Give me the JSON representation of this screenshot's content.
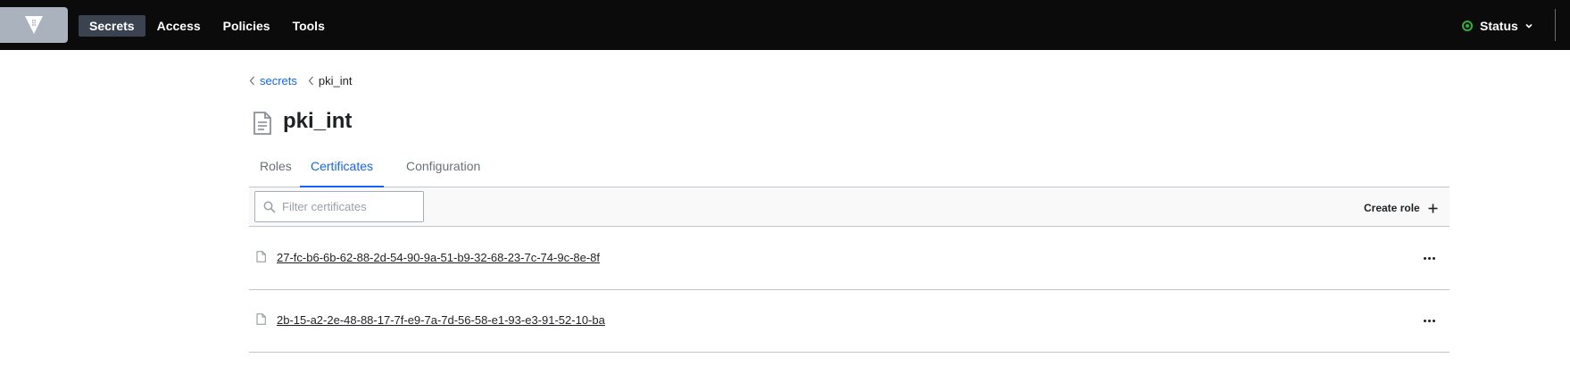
{
  "nav": {
    "logo_icon": "vault-logo-icon",
    "items": [
      {
        "label": "Secrets",
        "active": true
      },
      {
        "label": "Access",
        "active": false
      },
      {
        "label": "Policies",
        "active": false
      },
      {
        "label": "Tools",
        "active": false
      }
    ],
    "status": {
      "label": "Status",
      "state_color": "#2eb039"
    }
  },
  "breadcrumb": {
    "parent": "secrets",
    "current": "pki_int"
  },
  "page": {
    "title": "pki_int",
    "title_icon": "file-icon"
  },
  "tabs": [
    {
      "label": "Roles",
      "active": false
    },
    {
      "label": "Certificates",
      "active": true
    },
    {
      "label": "Configuration",
      "active": false
    }
  ],
  "toolbar": {
    "filter_placeholder": "Filter certificates",
    "filter_value": "",
    "create_label": "Create role"
  },
  "certificates": [
    {
      "serial": "27-fc-b6-6b-62-88-2d-54-90-9a-51-b9-32-68-23-7c-74-9c-8e-8f"
    },
    {
      "serial": "2b-15-a2-2e-48-88-17-7f-e9-7a-7d-56-58-e1-93-e3-91-52-10-ba"
    }
  ],
  "colors": {
    "accent": "#1563ff",
    "topbar": "#0b0b0b",
    "active_nav": "#3b4250"
  }
}
